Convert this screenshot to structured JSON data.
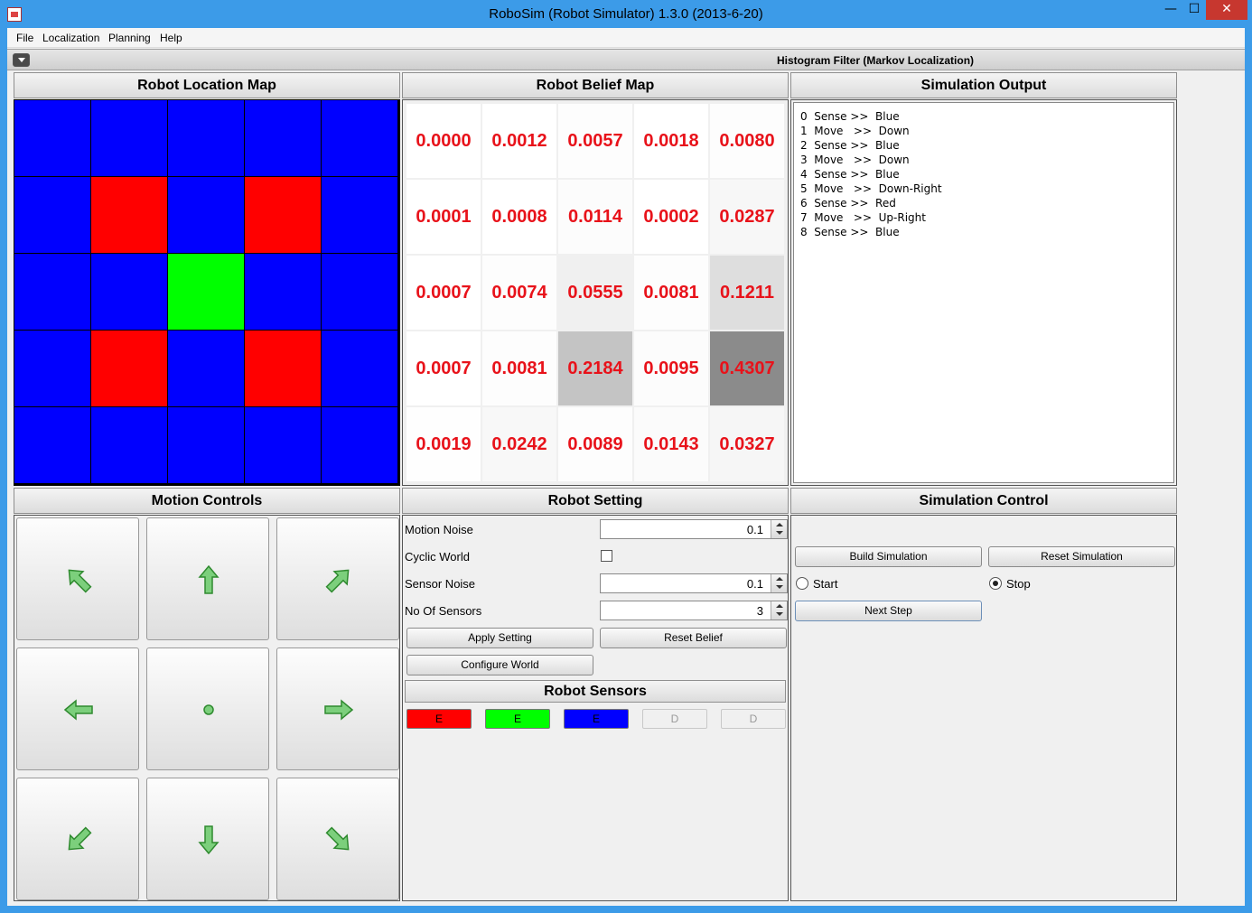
{
  "window": {
    "title": "RoboSim (Robot Simulator)  1.3.0 (2013-6-20)",
    "controls": {
      "minimize": "—",
      "maximize": "☐",
      "close": "✕"
    }
  },
  "menu": {
    "items": [
      "File",
      "Localization",
      "Planning",
      "Help"
    ]
  },
  "toolbar": {
    "title": "Histogram Filter (Markov Localization)"
  },
  "location_map": {
    "title": "Robot Location Map",
    "colors": {
      "B": "#0000ff",
      "R": "#ff0000",
      "G": "#00ff00"
    },
    "cells": [
      [
        "B",
        "B",
        "B",
        "B",
        "B"
      ],
      [
        "B",
        "R",
        "B",
        "R",
        "B"
      ],
      [
        "B",
        "B",
        "G",
        "B",
        "B"
      ],
      [
        "B",
        "R",
        "B",
        "R",
        "B"
      ],
      [
        "B",
        "B",
        "B",
        "B",
        "B"
      ]
    ]
  },
  "belief_map": {
    "title": "Robot Belief Map",
    "values": [
      [
        "0.0000",
        "0.0012",
        "0.0057",
        "0.0018",
        "0.0080"
      ],
      [
        "0.0001",
        "0.0008",
        "0.0114",
        "0.0002",
        "0.0287"
      ],
      [
        "0.0007",
        "0.0074",
        "0.0555",
        "0.0081",
        "0.1211"
      ],
      [
        "0.0007",
        "0.0081",
        "0.2184",
        "0.0095",
        "0.4307"
      ],
      [
        "0.0019",
        "0.0242",
        "0.0089",
        "0.0143",
        "0.0327"
      ]
    ]
  },
  "simulation_output": {
    "title": "Simulation Output",
    "lines": [
      "0  Sense >>  Blue",
      "1  Move   >>  Down",
      "2  Sense >>  Blue",
      "3  Move   >>  Down",
      "4  Sense >>  Blue",
      "5  Move   >>  Down-Right",
      "6  Sense >>  Red",
      "7  Move   >>  Up-Right",
      "8  Sense >>  Blue"
    ]
  },
  "motion_controls": {
    "title": "Motion Controls",
    "buttons": [
      "up-left",
      "up",
      "up-right",
      "left",
      "stay",
      "right",
      "down-left",
      "down",
      "down-right"
    ]
  },
  "robot_setting": {
    "title": "Robot Setting",
    "motion_noise_label": "Motion Noise",
    "motion_noise_value": "0.1",
    "cyclic_world_label": "Cyclic World",
    "sensor_noise_label": "Sensor Noise",
    "sensor_noise_value": "0.1",
    "no_of_sensors_label": "No Of Sensors",
    "no_of_sensors_value": "3",
    "apply_setting": "Apply Setting",
    "reset_belief": "Reset Belief",
    "configure_world": "Configure World"
  },
  "robot_sensors": {
    "title": "Robot Sensors",
    "sensors": [
      {
        "label": "E",
        "color": "#ff0000",
        "enabled": true
      },
      {
        "label": "E",
        "color": "#00ff00",
        "enabled": true
      },
      {
        "label": "E",
        "color": "#0000ff",
        "enabled": true
      },
      {
        "label": "D",
        "color": "#f0f0f0",
        "enabled": false
      },
      {
        "label": "D",
        "color": "#f0f0f0",
        "enabled": false
      }
    ]
  },
  "simulation_control": {
    "title": "Simulation Control",
    "build": "Build Simulation",
    "reset": "Reset Simulation",
    "start": "Start",
    "stop": "Stop",
    "selected": "Stop",
    "next_step": "Next Step"
  }
}
